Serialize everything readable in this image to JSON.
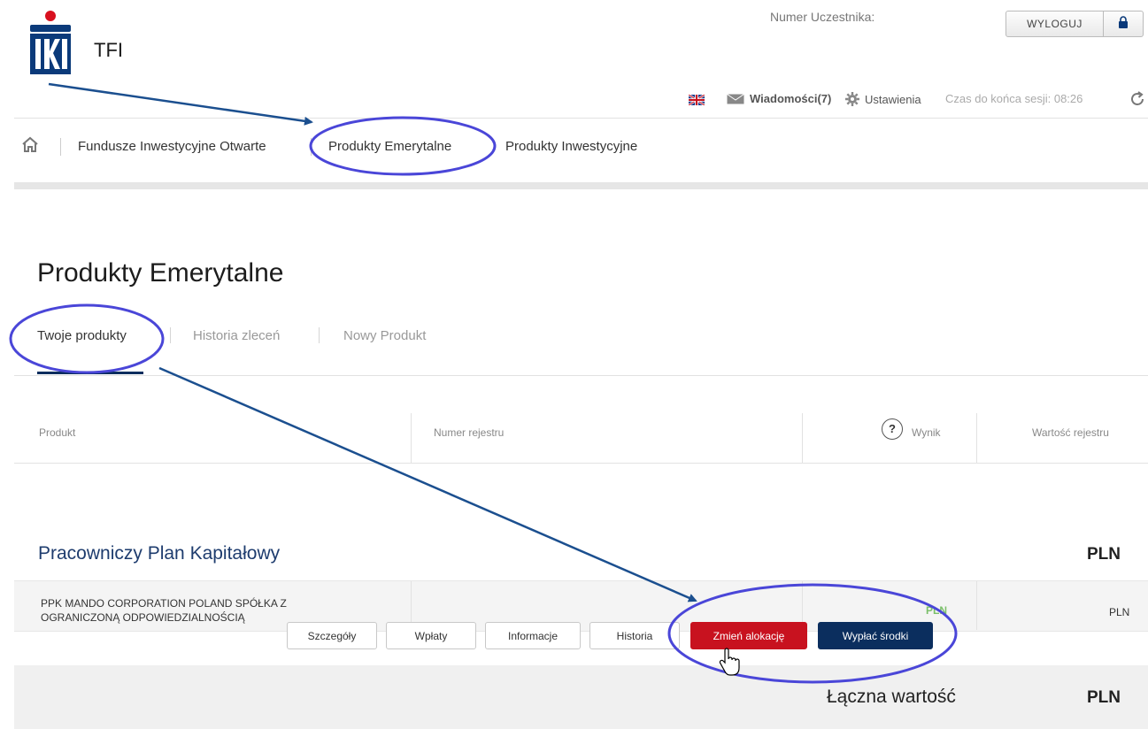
{
  "brand": {
    "logo_text": "TFI"
  },
  "header": {
    "participant_label": "Numer Uczestnika:",
    "logout_label": "WYLOGUJ",
    "logout_icon": "lock-icon"
  },
  "utility": {
    "language_icon": "uk-flag-icon",
    "messages_label": "Wiadomości(7)",
    "settings_label": "Ustawienia",
    "session_label": "Czas do końca sesji: 08:26",
    "refresh_icon": "refresh-icon"
  },
  "nav": {
    "items": [
      {
        "label": "Fundusze Inwestycyjne Otwarte"
      },
      {
        "label": "Produkty Emerytalne"
      },
      {
        "label": "Produkty Inwestycyjne"
      }
    ]
  },
  "page": {
    "title": "Produkty Emerytalne"
  },
  "tabs": [
    {
      "label": "Twoje produkty"
    },
    {
      "label": "Historia zleceń"
    },
    {
      "label": "Nowy Produkt"
    }
  ],
  "table": {
    "columns": [
      "Produkt",
      "Numer rejestru",
      "Wynik",
      "Wartość rejestru"
    ],
    "group": {
      "name": "Pracowniczy Plan Kapitałowy",
      "currency": "PLN"
    },
    "row": {
      "name_line1": "PPK MANDO CORPORATION POLAND SPÓŁKA Z",
      "name_line2": "OGRANICZONĄ ODPOWIEDZIALNOŚCIĄ",
      "result_currency": "PLN",
      "value_currency": "PLN"
    },
    "actions": [
      "Szczegóły",
      "Wpłaty",
      "Informacje",
      "Historia",
      "Zmień alokację",
      "Wypłać środki"
    ],
    "total": {
      "label": "Łączna wartość",
      "currency": "PLN"
    }
  },
  "colors": {
    "brand_navy": "#0b2e5e",
    "accent_red": "#c8121f",
    "annotation_blue": "#4a46d8",
    "arrow_navy": "#1b4f8f"
  }
}
